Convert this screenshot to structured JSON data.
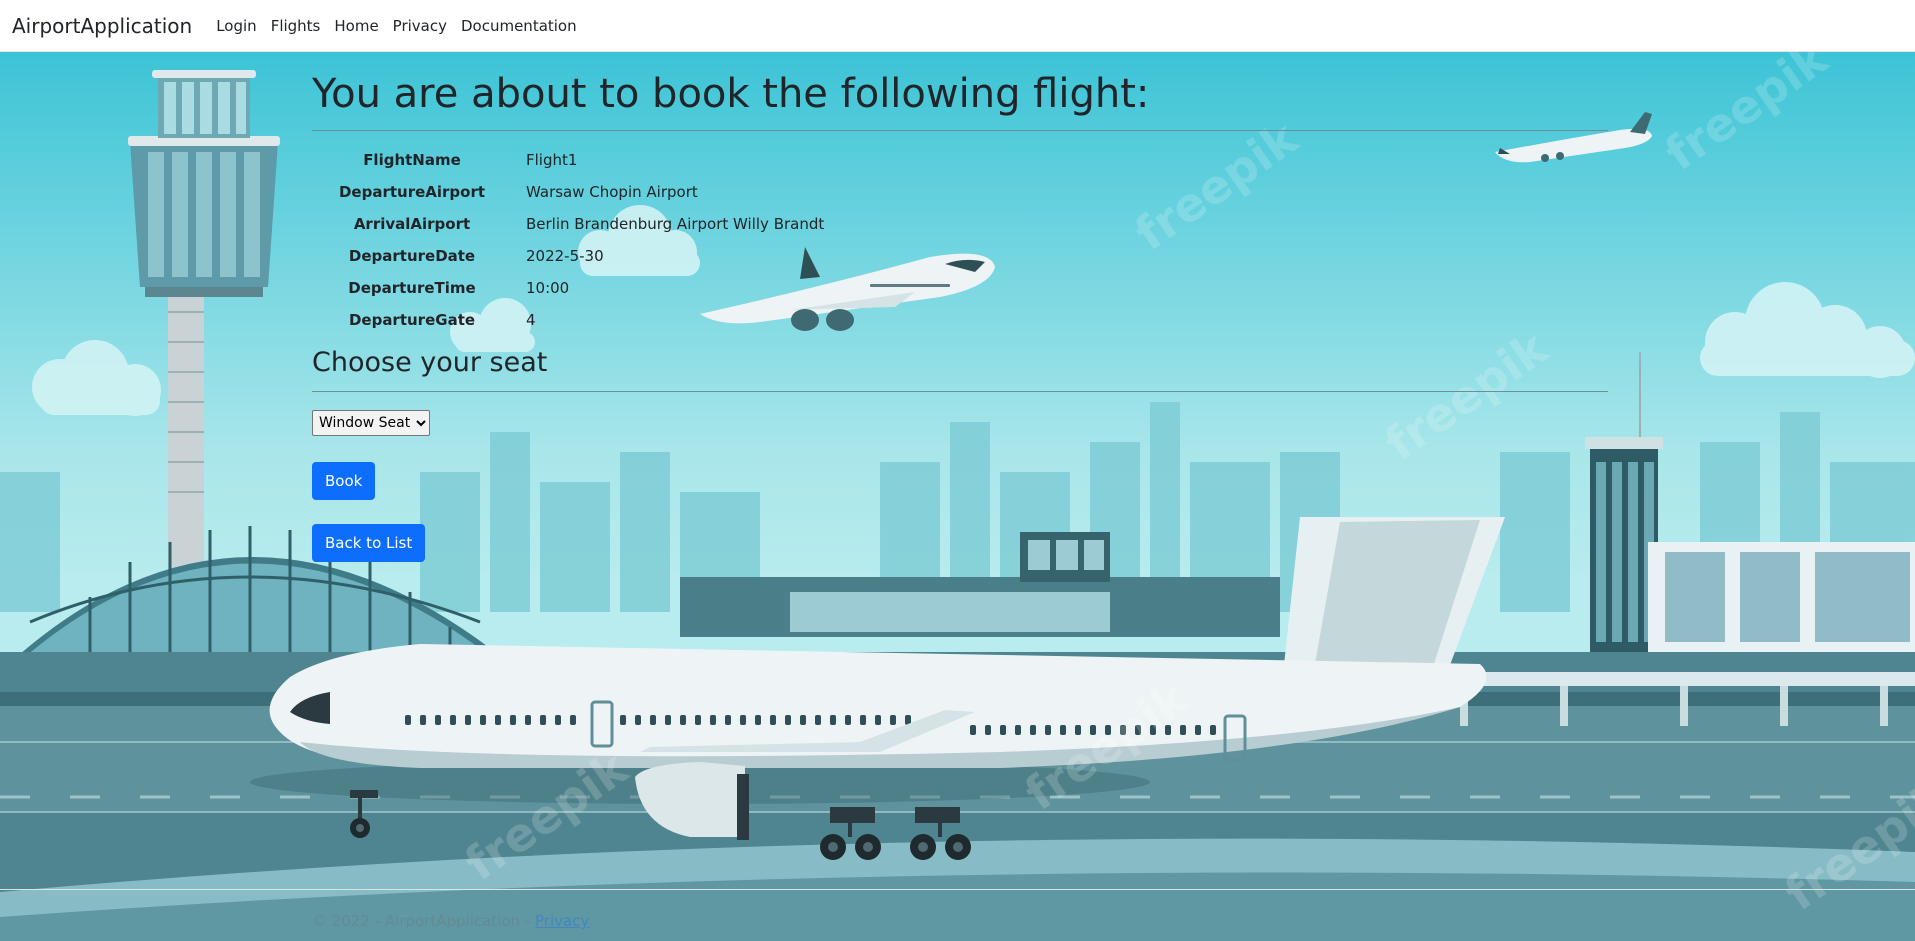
{
  "nav": {
    "brand": "AirportApplication",
    "links": [
      "Login",
      "Flights",
      "Home",
      "Privacy",
      "Documentation"
    ]
  },
  "main": {
    "title": "You are about to book the following flight:",
    "details": [
      {
        "label": "FlightName",
        "value": "Flight1"
      },
      {
        "label": "DepartureAirport",
        "value": "Warsaw Chopin Airport"
      },
      {
        "label": "ArrivalAirport",
        "value": "Berlin Brandenburg Airport Willy Brandt"
      },
      {
        "label": "DepartureDate",
        "value": "2022-5-30"
      },
      {
        "label": "DepartureTime",
        "value": "10:00"
      },
      {
        "label": "DepartureGate",
        "value": "4"
      }
    ],
    "seat_heading": "Choose your seat",
    "seat_select": {
      "selected": "Window Seat"
    },
    "book_label": "Book",
    "back_label": "Back to List"
  },
  "footer": {
    "text": "© 2022 - AirportApplication - ",
    "link": "Privacy"
  },
  "colors": {
    "primary": "#0d6efd",
    "sky_top": "#3cc4d6",
    "sky_bottom": "#a8e6ea"
  }
}
